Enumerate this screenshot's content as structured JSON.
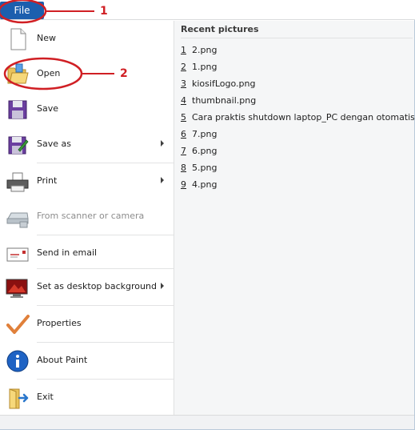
{
  "file_tab": {
    "label": "File"
  },
  "commands": [
    {
      "label": "New",
      "icon": "new-document-icon",
      "submenu": false,
      "disabled": false
    },
    {
      "label": "Open",
      "icon": "open-folder-icon",
      "submenu": false,
      "disabled": false
    },
    {
      "label": "Save",
      "icon": "save-disk-icon",
      "submenu": false,
      "disabled": false
    },
    {
      "label": "Save as",
      "icon": "save-as-icon",
      "submenu": true,
      "disabled": false
    },
    {
      "label": "Print",
      "icon": "printer-icon",
      "submenu": true,
      "disabled": false
    },
    {
      "label": "From scanner or camera",
      "icon": "scanner-icon",
      "submenu": false,
      "disabled": true
    },
    {
      "label": "Send in email",
      "icon": "email-icon",
      "submenu": false,
      "disabled": false
    },
    {
      "label": "Set as desktop background",
      "icon": "desktop-background-icon",
      "submenu": true,
      "disabled": false
    },
    {
      "label": "Properties",
      "icon": "checkmark-icon",
      "submenu": false,
      "disabled": false
    },
    {
      "label": "About Paint",
      "icon": "info-icon",
      "submenu": false,
      "disabled": false
    },
    {
      "label": "Exit",
      "icon": "exit-door-icon",
      "submenu": false,
      "disabled": false
    }
  ],
  "recent": {
    "title": "Recent pictures",
    "items": [
      {
        "num": "1",
        "name": "2.png"
      },
      {
        "num": "2",
        "name": "1.png"
      },
      {
        "num": "3",
        "name": "kiosifLogo.png"
      },
      {
        "num": "4",
        "name": "thumbnail.png"
      },
      {
        "num": "5",
        "name": "Cara praktis shutdown laptop_PC dengan otomatis ..."
      },
      {
        "num": "6",
        "name": "7.png"
      },
      {
        "num": "7",
        "name": "6.png"
      },
      {
        "num": "8",
        "name": "5.png"
      },
      {
        "num": "9",
        "name": "4.png"
      }
    ]
  },
  "annotations": {
    "label_1": "1",
    "label_2": "2",
    "color": "#d01f24"
  },
  "colors": {
    "file_tab": "#1c5fae",
    "panel_bg": "#f5f6f7"
  }
}
